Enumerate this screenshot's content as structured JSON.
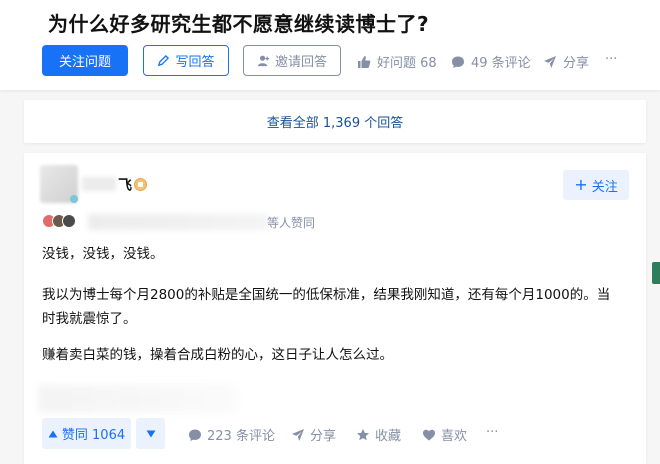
{
  "question": {
    "title": "为什么好多研究生都不愿意继续读博士了?",
    "follow_label": "关注问题",
    "write_label": "写回答",
    "invite_label": "邀请回答",
    "good_question_label": "好问题 68",
    "comments_label": "49 条评论",
    "share_label": "分享",
    "more_label": "···"
  },
  "view_all_label": "查看全部 1,369 个回答",
  "answer": {
    "author_name_suffix": "飞",
    "follow_label": "关注",
    "voters_text": "等人赞同",
    "paragraphs": [
      "没钱，没钱，没钱。",
      "我以为博士每个月2800的补贴是全国统一的低保标准，结果我刚知道，还有每个月1000的。当时我就震惊了。",
      "赚着卖白菜的钱，操着合成白粉的心，这日子让人怎么过。"
    ],
    "vote_label": "赞同 1064",
    "comments_label": "223 条评论",
    "share_label": "分享",
    "collect_label": "收藏",
    "like_label": "喜欢",
    "more_label": "···"
  },
  "colors": {
    "brand_blue": "#1772f6",
    "link_blue": "#175199",
    "muted_gray": "#8590a6",
    "light_blue_bg": "#ebf2fd"
  },
  "icons": [
    "pen-icon",
    "invite-user-icon",
    "thumb-up-icon",
    "comment-icon",
    "share-icon",
    "more-icon",
    "badge-icon",
    "plus-icon",
    "triangle-up-icon",
    "triangle-down-icon",
    "star-icon",
    "heart-icon"
  ]
}
